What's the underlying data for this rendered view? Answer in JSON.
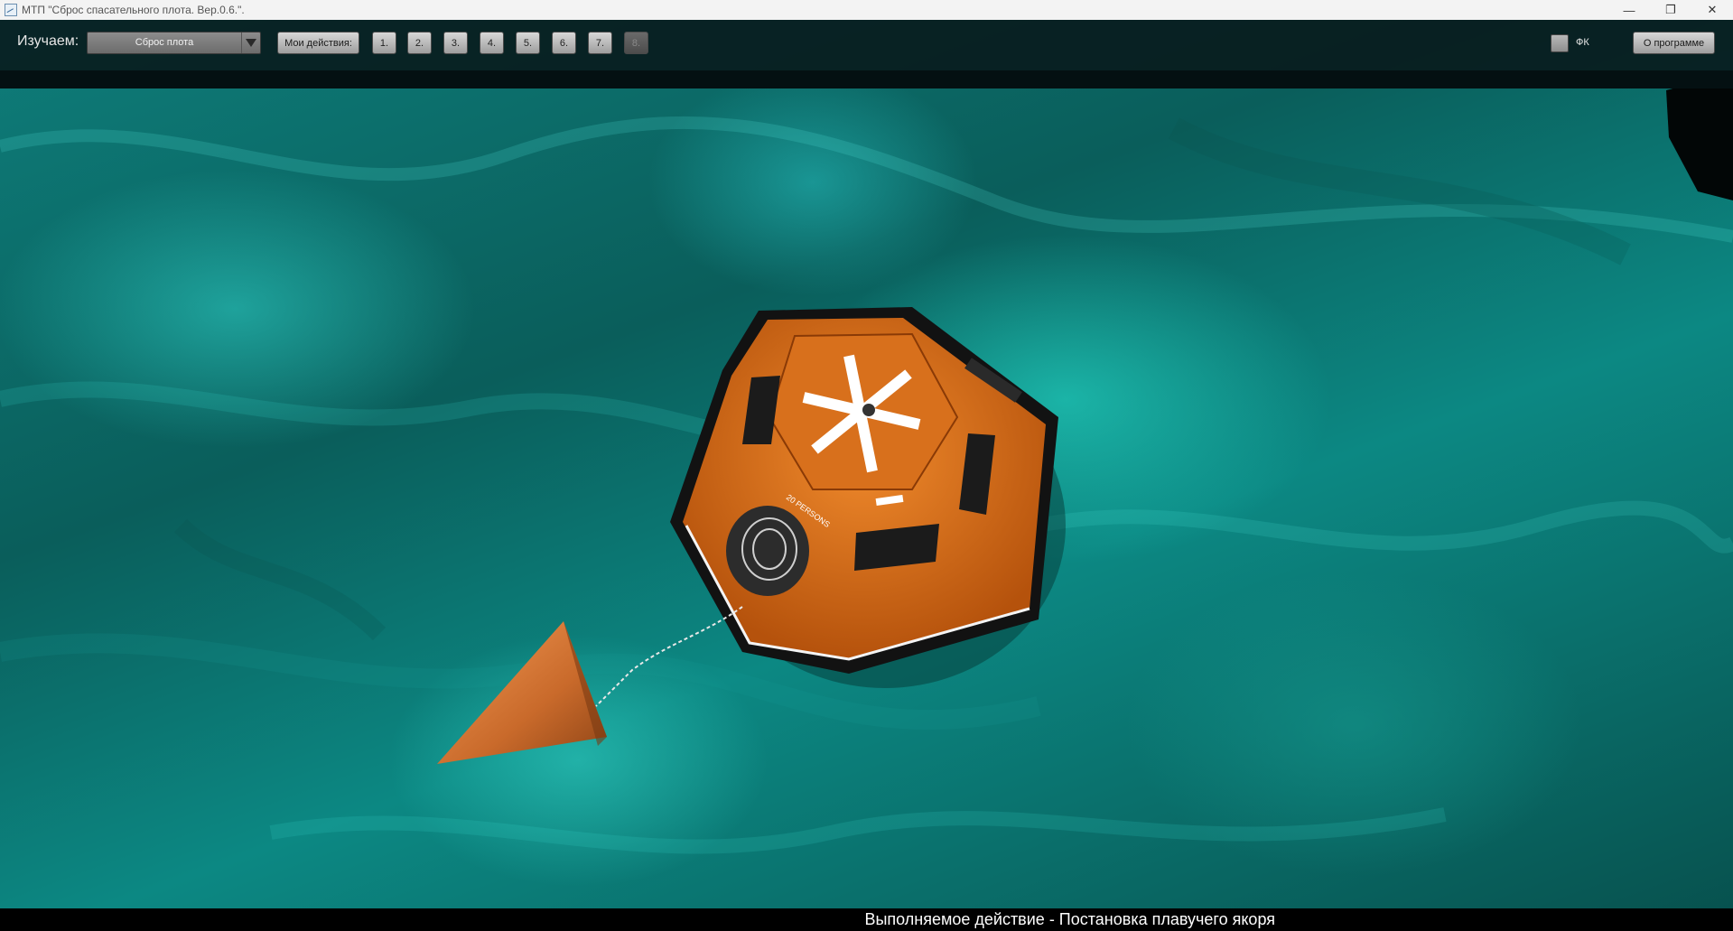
{
  "window": {
    "title": "МТП \"Сброс спасательного плота. Вер.0.6.\".",
    "controls": {
      "minimize": "—",
      "restore": "❐",
      "close": "✕"
    }
  },
  "toolbar": {
    "study_label": "Изучаем:",
    "study_dropdown": {
      "value": "Сброс плота"
    },
    "my_actions_label": "Мои действия:",
    "steps": [
      "1.",
      "2.",
      "3.",
      "4.",
      "5.",
      "6.",
      "7.",
      "8."
    ],
    "checkbox_label": "ФК",
    "about_label": "О программе"
  },
  "scene": {
    "raft_label": "20 PERSONS"
  },
  "status": {
    "current_action": "Выполняемое действие - Постановка плавучего якоря"
  },
  "colors": {
    "raft_orange": "#d9660f",
    "water": "#0c8883",
    "toolbar_bg": "#08181a"
  }
}
